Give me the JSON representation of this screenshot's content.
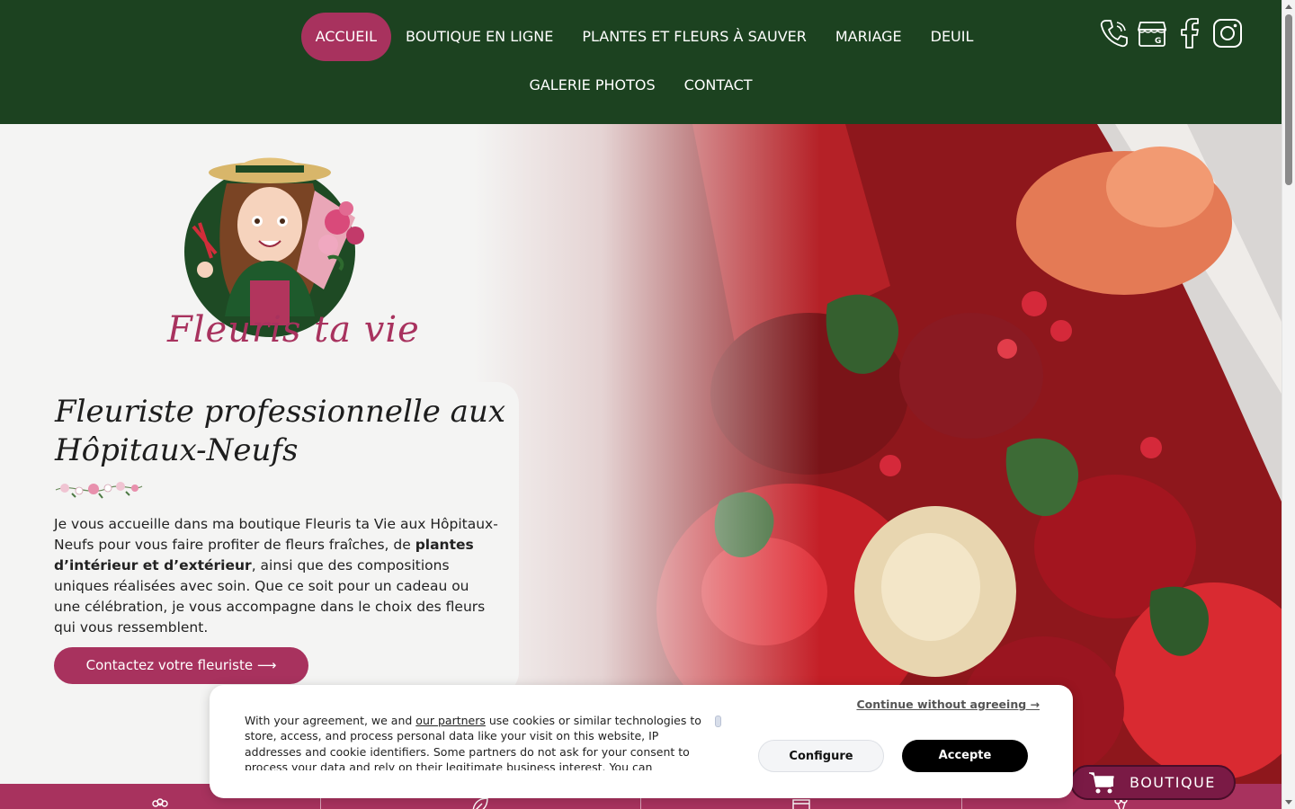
{
  "nav": {
    "row1": [
      "ACCUEIL",
      "BOUTIQUE EN LIGNE",
      "PLANTES ET FLEURS À SAUVER",
      "MARIAGE",
      "DEUIL"
    ],
    "row2": [
      "GALERIE PHOTOS",
      "CONTACT"
    ],
    "active_label": "ACCUEIL"
  },
  "social_icons": [
    "phone-icon",
    "google-business-icon",
    "facebook-icon",
    "instagram-icon"
  ],
  "logo": {
    "text": "Fleuris ta vie"
  },
  "hero": {
    "title": "Fleuriste professionnelle aux Hôpitaux-Neufs",
    "paragraph": {
      "part1": "Je vous accueille dans ma boutique Fleuris ta Vie aux Hôpitaux-Neufs pour vous faire profiter de fleurs fraîches, de ",
      "bold": "plantes d’intérieur et d’extérieur",
      "part2": ", ainsi que des compositions uniques réalisées avec soin. Que ce soit pour un cadeau ou une célébration, je vous accompagne dans le choix des fleurs qui vous ressemblent."
    },
    "cta_label": "Contactez votre fleuriste ⟶"
  },
  "cookie": {
    "text_before_link": "With your agreement, we and ",
    "link": "our partners",
    "text_after_link": " use cookies or similar technologies to store, access, and process personal data like your visit on this website, IP addresses and cookie identifiers. Some partners do not ask for your consent to process your data and rely on their legitimate business interest. You can",
    "continue": "Continue without agreeing →",
    "configure": "Configure",
    "accept": "Accepte"
  },
  "boutique_button": {
    "label": "BOUTIQUE",
    "icon": "cart-icon"
  },
  "feature_strip_icons": [
    "flower-icon",
    "leaf-icon",
    "box-icon",
    "bouquet-icon"
  ],
  "colors": {
    "header_green": "#1c4220",
    "accent": "#a8325e",
    "boutique_dark": "#7a1a45"
  }
}
